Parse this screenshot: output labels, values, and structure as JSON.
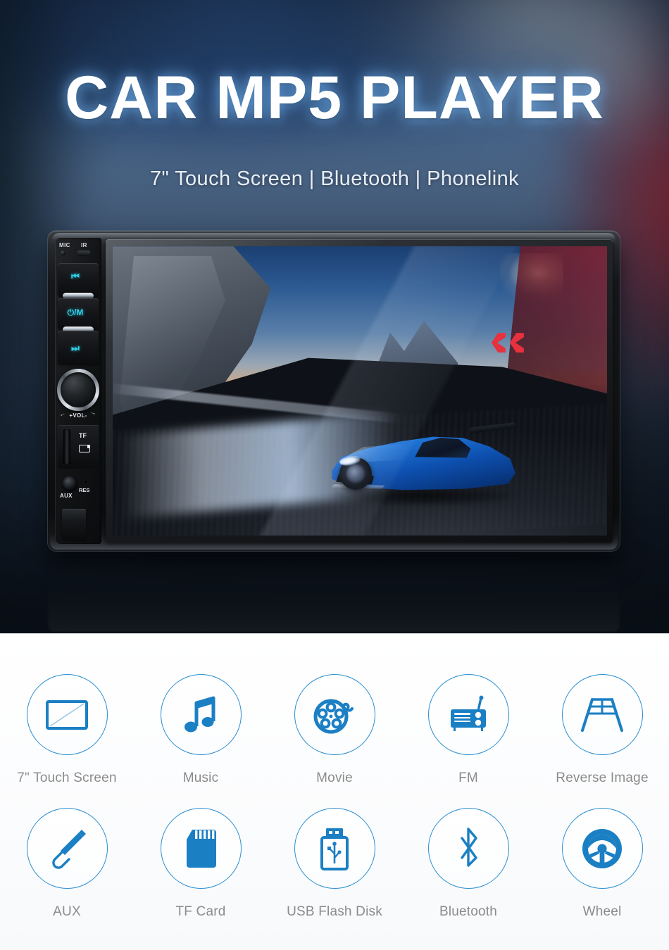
{
  "hero": {
    "title": "CAR MP5 PLAYER",
    "subtitle": "7\" Touch Screen | Bluetooth | Phonelink",
    "accent_color": "#1b7fc4",
    "title_glow_color": "#78beff"
  },
  "device": {
    "name": "car-mp5-head-unit",
    "controls": {
      "mic_label": "MIC",
      "ir_label": "IR",
      "prev_glyph": "⏮",
      "power_label": "⏻/M",
      "next_glyph": "⏭",
      "volume_label": "+VOL-",
      "volume_arrow_left": "←",
      "volume_arrow_right": "→",
      "tf_label": "TF",
      "aux_label": "AUX",
      "res_label": "RES"
    },
    "screen": {
      "content_description": "blue sports car driving on a mountain coastal road at dusk"
    }
  },
  "features": {
    "row1": [
      {
        "icon": "touch-screen-icon",
        "label": "7\" Touch Screen"
      },
      {
        "icon": "music-note-icon",
        "label": "Music"
      },
      {
        "icon": "film-reel-icon",
        "label": "Movie"
      },
      {
        "icon": "radio-icon",
        "label": "FM"
      },
      {
        "icon": "reverse-image-icon",
        "label": "Reverse Image"
      }
    ],
    "row2": [
      {
        "icon": "aux-plug-icon",
        "label": "AUX"
      },
      {
        "icon": "sd-card-icon",
        "label": "TF Card"
      },
      {
        "icon": "usb-flash-drive-icon",
        "label": "USB Flash Disk"
      },
      {
        "icon": "bluetooth-icon",
        "label": "Bluetooth"
      },
      {
        "icon": "steering-wheel-icon",
        "label": "Wheel"
      }
    ],
    "circle_border_color": "#2a8ed0",
    "icon_color": "#1b7fc4",
    "label_color": "#8b8b8b"
  }
}
